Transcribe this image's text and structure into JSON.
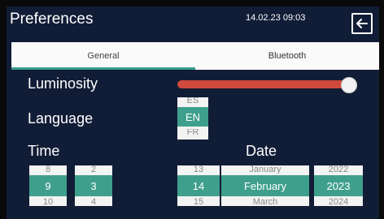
{
  "header": {
    "title": "Preferences",
    "datetime": "14.02.23 09:03",
    "back_icon": "arrow-left-icon"
  },
  "tabs": [
    {
      "label": "General",
      "active": true
    },
    {
      "label": "Bluetooth",
      "active": false
    }
  ],
  "settings": {
    "luminosity": {
      "label": "Luminosity",
      "value_fraction": 0.97
    },
    "language": {
      "label": "Language",
      "prev": "ES",
      "selected": "EN",
      "next": "FR"
    },
    "time": {
      "label": "Time",
      "hour": {
        "prev": "8",
        "selected": "9",
        "next": "10"
      },
      "minute": {
        "prev": "2",
        "selected": "3",
        "next": "4"
      }
    },
    "date": {
      "label": "Date",
      "day": {
        "prev": "13",
        "selected": "14",
        "next": "15"
      },
      "month": {
        "prev": "January",
        "selected": "February",
        "next": "March"
      },
      "year": {
        "prev": "2022",
        "selected": "2023",
        "next": "2024"
      }
    }
  },
  "colors": {
    "background": "#111c36",
    "accent": "#3f9f8d",
    "slider": "#cf4a3c"
  }
}
